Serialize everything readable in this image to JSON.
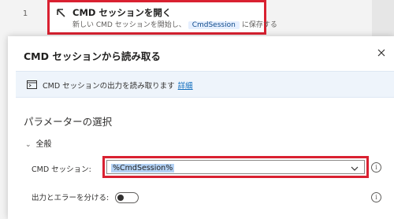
{
  "flow": {
    "row_number": "1",
    "step": {
      "title": "CMD セッションを開く",
      "desc_prefix": "新しい CMD セッションを開始し、",
      "variable": "CmdSession",
      "desc_suffix": "に保存する"
    }
  },
  "dialog": {
    "title": "CMD セッションから読み取る",
    "close_icon": "close-icon",
    "info": {
      "text": "CMD セッションの出力を読み取ります",
      "link": "詳細"
    },
    "section_title": "パラメーターの選択",
    "group": {
      "label": "全般",
      "expanded": true
    },
    "fields": {
      "cmd_session": {
        "label": "CMD セッション:",
        "value": "%CmdSession%"
      },
      "separate_output": {
        "label": "出力とエラーを分ける:",
        "on": false
      }
    }
  },
  "colors": {
    "highlight_border": "#d92131",
    "link": "#0f6cbd",
    "info_bg": "#eef4fb",
    "selection_bg": "#b3d1f4"
  }
}
